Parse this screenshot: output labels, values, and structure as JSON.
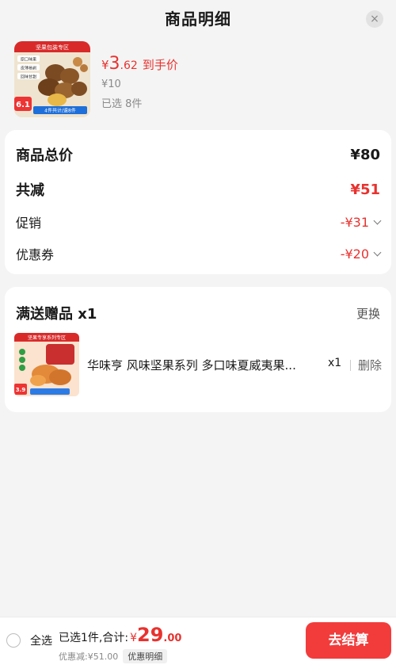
{
  "header": {
    "title": "商品明细",
    "close_icon": "×"
  },
  "product": {
    "price_symbol": "¥",
    "price_int": "3",
    "price_dec": ".62",
    "price_label": "到手价",
    "original_price": "¥10",
    "selected_count": "已选 8件",
    "thumb_banner": "坚果包装专区",
    "thumb_tags": [
      "原口味果",
      "皮薄易剥",
      "回味甘甜"
    ],
    "thumb_price": "6.1",
    "thumb_bottom": "4件共计/速8件"
  },
  "price_card": {
    "total_label": "商品总价",
    "total_value": "¥80",
    "reduce_label": "共减",
    "reduce_value": "¥51",
    "promo_label": "促销",
    "promo_value": "-¥31",
    "coupon_label": "优惠券",
    "coupon_value": "-¥20"
  },
  "gift_card": {
    "title": "满送赠品 x1",
    "change_label": "更换",
    "item_name": "华味亨 风味坚果系列 多口味夏威夷果...",
    "item_qty": "x1",
    "delete_label": "删除",
    "thumb_banner": "坚果专享系列专区",
    "thumb_price": "3.9"
  },
  "bottom_bar": {
    "select_all": "全选",
    "summary_prefix": "已选1件,合计:",
    "total_symbol": "¥",
    "total_int": "29",
    "total_dec": ".00",
    "discount_text": "优惠减:¥51.00",
    "detail_label": "优惠明细",
    "checkout_label": "去结算"
  },
  "colors": {
    "accent_red": "#e8322f",
    "checkout_red": "#f23c3c",
    "background": "#f4f4f4"
  }
}
